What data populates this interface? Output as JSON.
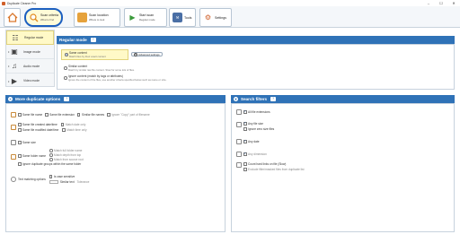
{
  "window": {
    "title": "Duplicate Cleaner Pro",
    "minimize": "–",
    "maximize": "☐",
    "close": "✕"
  },
  "ribbon": {
    "home_icon": "home-icon",
    "scan_criteria": {
      "t1": "Scan criteria",
      "t2": "What to find"
    },
    "scan_location": {
      "t1": "Scan location",
      "t2": "Where to look"
    },
    "start_scan": {
      "t1": "Start scan",
      "t2": "Regular mode"
    },
    "tools": {
      "t1": "Tools"
    },
    "settings": {
      "t1": "Settings"
    }
  },
  "modes": [
    {
      "label": "Regular mode",
      "icon": "regular-mode-icon",
      "glyph": "☷",
      "selected": true
    },
    {
      "label": "Image mode",
      "icon": "image-mode-icon",
      "glyph": "▣",
      "selected": false
    },
    {
      "label": "Audio mode",
      "icon": "audio-mode-icon",
      "glyph": "♫",
      "selected": false
    },
    {
      "label": "Video mode",
      "icon": "video-mode-icon",
      "glyph": "▶",
      "selected": false
    }
  ],
  "regular_mode": {
    "title": "Regular mode",
    "help": "?",
    "same_content": "Same content",
    "same_content_sub": "Match files by their exact content",
    "advanced_settings": "Advanced settings",
    "similar_content": "Similar content",
    "similar_content_sub": "Match by similar raw file content. Slow for some lots of files.",
    "ignore_content": "Ignore content (match by tags or attributes)",
    "ignore_content_sub": "Ignore the content of the files, use another criteria specified below such as name or size."
  },
  "more_options": {
    "title": "More duplicate options",
    "help": "?",
    "same_file_name": "Same file name",
    "same_file_extension": "Same file extension",
    "similar_file_names": "Similar file names",
    "ignore_copy": "Ignore \"Copy\" part of filename",
    "same_created": "Same file created date/time",
    "same_modified": "Same file modified date/time",
    "match_date_only": "Match date only",
    "match_time_only": "Match time only",
    "same_size": "Same size",
    "same_folder_name": "Same folder name",
    "match_full_folder": "Match full folder name",
    "match_depth": "Match depth from top",
    "match_from_source": "Match from source root",
    "ignore_dup_groups": "Ignore duplicate groups within the same folder",
    "text_matching": "Text matching options",
    "is_case_sensitive": "Is case sensitive",
    "similar_text": "Similar text",
    "tolerance": "Tolerance"
  },
  "search_filters": {
    "title": "Search filters",
    "help": "?",
    "all_file_extensions": "All file extensions",
    "any_file_size": "Any file size",
    "ignore_zero": "Ignore zero size files",
    "any_date": "Any date",
    "any_dimension": "Any dimension",
    "count_hard_links": "Count hard links on file (Slow)",
    "exclude_filtered": "Exclude filter/masked files from duplicate list"
  }
}
